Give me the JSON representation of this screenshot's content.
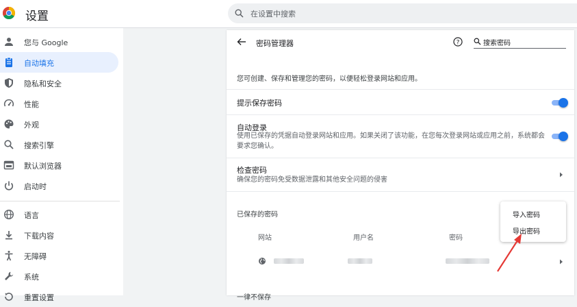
{
  "header": {
    "title": "设置",
    "search_placeholder": "在设置中搜索"
  },
  "sidebar": {
    "items": [
      {
        "label": "您与 Google",
        "icon": "person-icon"
      },
      {
        "label": "自动填充",
        "icon": "autofill-icon",
        "active": true
      },
      {
        "label": "隐私和安全",
        "icon": "shield-icon"
      },
      {
        "label": "性能",
        "icon": "speedometer-icon"
      },
      {
        "label": "外观",
        "icon": "palette-icon"
      },
      {
        "label": "搜索引擎",
        "icon": "search-icon"
      },
      {
        "label": "默认浏览器",
        "icon": "browser-icon"
      },
      {
        "label": "启动时",
        "icon": "power-icon"
      },
      {
        "label": "语言",
        "icon": "globe-icon"
      },
      {
        "label": "下载内容",
        "icon": "download-icon"
      },
      {
        "label": "无障碍",
        "icon": "accessibility-icon"
      },
      {
        "label": "系统",
        "icon": "wrench-icon"
      },
      {
        "label": "重置设置",
        "icon": "reset-icon"
      }
    ]
  },
  "main": {
    "title": "密码管理器",
    "search_placeholder": "搜索密码",
    "description": "您可创建、保存和管理您的密码，以便轻松登录网站和应用。",
    "offer_to_save": {
      "label": "提示保存密码",
      "enabled": true
    },
    "auto_signin": {
      "label": "自动登录",
      "description_line1": "使用已保存的凭据自动登录网站和应用。如果关闭了该功能，在您每次登录网站或应用之前，系统都会",
      "description_line2": "要求您确认。",
      "enabled": true
    },
    "check_passwords": {
      "label": "检查密码",
      "description": "确保您的密码免受数据泄露和其他安全问题的侵害"
    },
    "saved_passwords": {
      "title": "已保存的密码",
      "columns": [
        "网站",
        "用户名",
        "密码"
      ]
    },
    "never_saved": {
      "title": "一律不保存"
    }
  },
  "menu": {
    "items": [
      "导入密码",
      "导出密码"
    ]
  },
  "colors": {
    "accent": "#1a73e8",
    "active_bg": "#e8f0fe",
    "annotation": "#e53935"
  }
}
